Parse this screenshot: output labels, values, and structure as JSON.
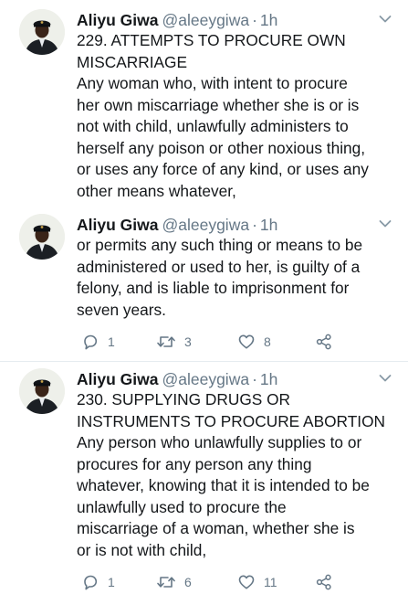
{
  "tweets": [
    {
      "author": {
        "name": "Aliyu Giwa",
        "handle": "@aleeygiwa"
      },
      "separator": "·",
      "time": "1h",
      "lines": [
        "229. ATTEMPTS TO PROCURE OWN",
        "MISCARRIAGE",
        "Any woman who, with intent to procure",
        "her own miscarriage whether she is or is",
        "not with child, unlawfully administers to",
        "herself any poison or other noxious thing,",
        "or uses any force of any kind, or uses any",
        "other means whatever,"
      ]
    },
    {
      "author": {
        "name": "Aliyu Giwa",
        "handle": "@aleeygiwa"
      },
      "separator": "·",
      "time": "1h",
      "lines": [
        "or permits any such thing or means to be",
        "administered or used to her, is guilty of a",
        "felony, and is liable to imprisonment for",
        "seven years."
      ],
      "counts": {
        "replies": "1",
        "retweets": "3",
        "likes": "8"
      }
    },
    {
      "author": {
        "name": "Aliyu Giwa",
        "handle": "@aleeygiwa"
      },
      "separator": "·",
      "time": "1h",
      "lines": [
        "230. SUPPLYING DRUGS OR",
        "INSTRUMENTS TO PROCURE ABORTION",
        " Any person who unlawfully supplies to or",
        "procures for any person any thing",
        "whatever, knowing that it is intended to be",
        "unlawfully used to procure the",
        "miscarriage of a woman, whether she is",
        "or is not with child,"
      ],
      "counts": {
        "replies": "1",
        "retweets": "6",
        "likes": "11"
      }
    }
  ],
  "icons": {
    "caret": "chevron-down-icon",
    "reply": "reply-icon",
    "retweet": "retweet-icon",
    "like": "heart-icon",
    "share": "share-icon"
  },
  "colors": {
    "text": "#14171a",
    "secondary": "#657786",
    "divider": "#e6ecf0",
    "avatar_uniform": "#1b1f24"
  }
}
